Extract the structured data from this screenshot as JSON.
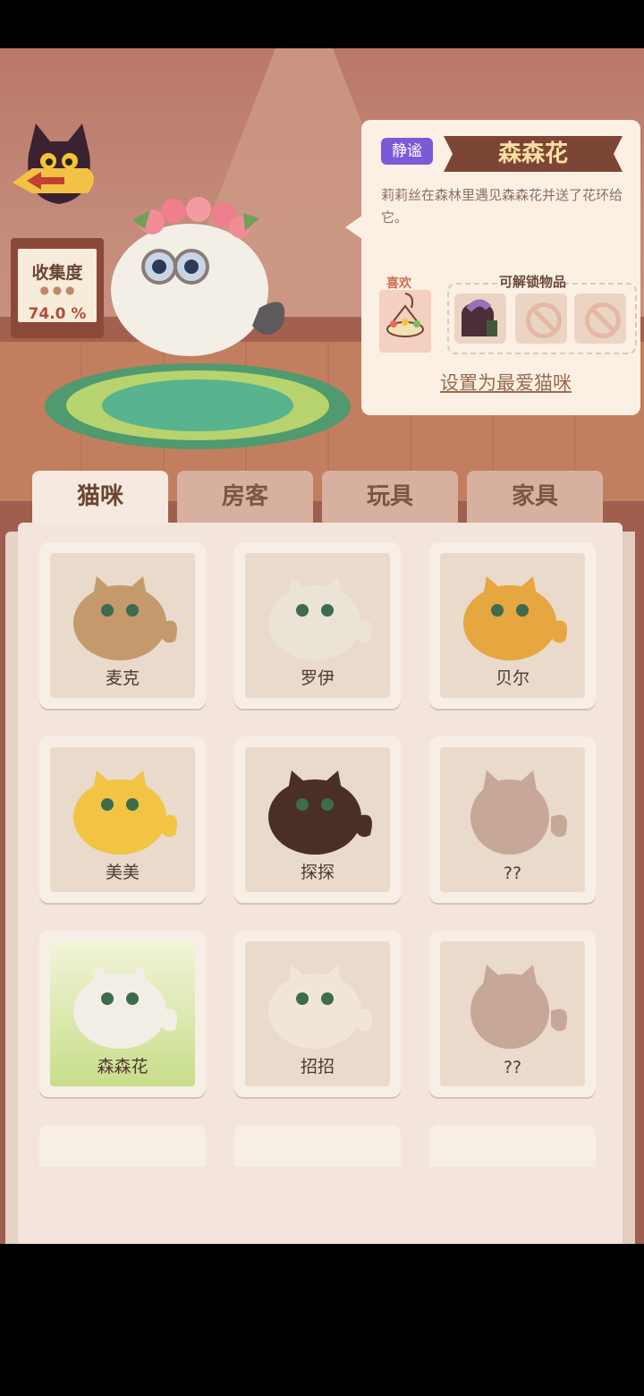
{
  "collection": {
    "label": "收集度",
    "value": "74.0 %"
  },
  "detail": {
    "tag": "静谧",
    "name": "森森花",
    "description": "莉莉丝在森林里遇见森森花并送了花环给它。",
    "like_label": "喜欢",
    "unlock_label": "可解锁物品",
    "favorite_link": "设置为最爱猫咪"
  },
  "tabs": [
    {
      "label": "猫咪",
      "active": true
    },
    {
      "label": "房客",
      "active": false
    },
    {
      "label": "玩具",
      "active": false
    },
    {
      "label": "家具",
      "active": false
    }
  ],
  "cats": [
    {
      "name": "麦克",
      "color": "#c49a6c",
      "locked": false
    },
    {
      "name": "罗伊",
      "color": "#eae3d6",
      "locked": false
    },
    {
      "name": "贝尔",
      "color": "#e6a640",
      "locked": false
    },
    {
      "name": "美美",
      "color": "#f2c443",
      "locked": false
    },
    {
      "name": "探探",
      "color": "#4a2f27",
      "locked": false
    },
    {
      "name": "??",
      "color": "#c7a798",
      "locked": true
    },
    {
      "name": "森森花",
      "color": "#f2eee6",
      "locked": false,
      "selected": true
    },
    {
      "name": "招招",
      "color": "#f1e6d6",
      "locked": false
    },
    {
      "name": "??",
      "color": "#c7a798",
      "locked": true
    }
  ],
  "icons": {
    "back": "back-arrow-fish-icon",
    "disabled_slot": "prohibited-icon"
  }
}
